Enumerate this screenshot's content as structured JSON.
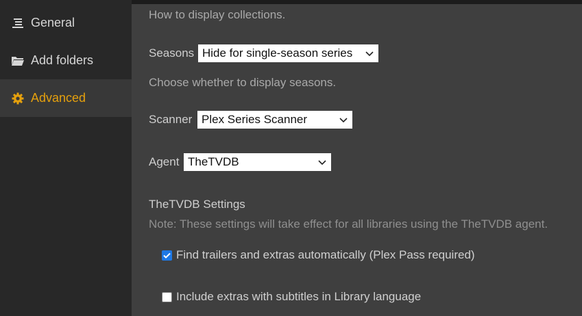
{
  "sidebar": {
    "items": [
      {
        "label": "General",
        "icon": "list-icon"
      },
      {
        "label": "Add folders",
        "icon": "folder-icon"
      },
      {
        "label": "Advanced",
        "icon": "gear-icon",
        "active": true
      }
    ]
  },
  "main": {
    "collections_help": "How to display collections.",
    "seasons": {
      "label": "Seasons",
      "value": "Hide for single-season series",
      "help": "Choose whether to display seasons."
    },
    "scanner": {
      "label": "Scanner",
      "value": "Plex Series Scanner"
    },
    "agent": {
      "label": "Agent",
      "value": "TheTVDB"
    },
    "agent_settings": {
      "heading": "TheTVDB Settings",
      "note": "Note: These settings will take effect for all libraries using the TheTVDB agent.",
      "options": [
        {
          "label": "Find trailers and extras automatically (Plex Pass required)",
          "checked": true
        },
        {
          "label": "Include extras with subtitles in Library language",
          "checked": false
        }
      ]
    }
  },
  "colors": {
    "accent": "#e5a00d",
    "checkbox": "#1e78e4",
    "sidebar_bg": "#282828",
    "main_bg": "#3f3f3f"
  }
}
